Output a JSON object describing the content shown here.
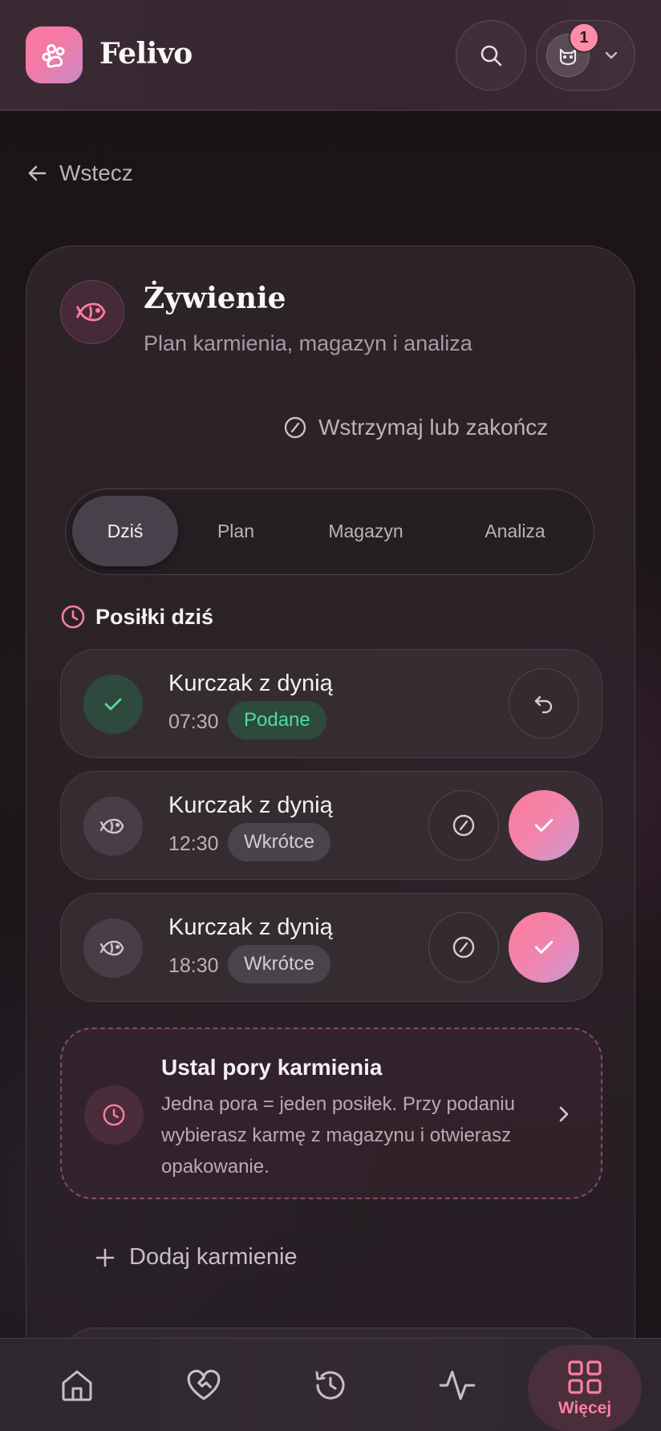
{
  "app": {
    "name": "Felivo",
    "notification_count": "1"
  },
  "nav": {
    "back_label": "Wstecz"
  },
  "section": {
    "title": "Żywienie",
    "subtitle": "Plan karmienia, magazyn i analiza",
    "pause_label": "Wstrzymaj lub zakończ"
  },
  "tabs": [
    {
      "label": "Dziś",
      "active": true
    },
    {
      "label": "Plan",
      "active": false
    },
    {
      "label": "Magazyn",
      "active": false
    },
    {
      "label": "Analiza",
      "active": false
    }
  ],
  "meals": {
    "title": "Posiłki dziś",
    "items": [
      {
        "name": "Kurczak z dynią",
        "time": "07:30",
        "status": "Podane",
        "state": "served"
      },
      {
        "name": "Kurczak z dynią",
        "time": "12:30",
        "status": "Wkrótce",
        "state": "soon"
      },
      {
        "name": "Kurczak z dynią",
        "time": "18:30",
        "status": "Wkrótce",
        "state": "soon"
      }
    ]
  },
  "schedule": {
    "title": "Ustal pory karmienia",
    "description": "Jedna pora = jeden posiłek. Przy podaniu wybierasz karmę z magazynu i otwierasz opakowanie."
  },
  "add_label": "Dodaj karmienie",
  "bottom_nav": {
    "more_label": "Więcej"
  },
  "colors": {
    "accent": "#ff7ea0",
    "served_green": "#4fdc9d",
    "background": "#1c1519"
  },
  "icons": [
    "paw-icon",
    "search-icon",
    "cat-icon",
    "chevron-down-icon",
    "arrow-left-icon",
    "fish-icon",
    "ban-icon",
    "clock-icon",
    "check-icon",
    "undo-icon",
    "chevron-right-icon",
    "plus-icon",
    "home-icon",
    "heart-handshake-icon",
    "history-icon",
    "activity-icon",
    "grid-icon"
  ]
}
